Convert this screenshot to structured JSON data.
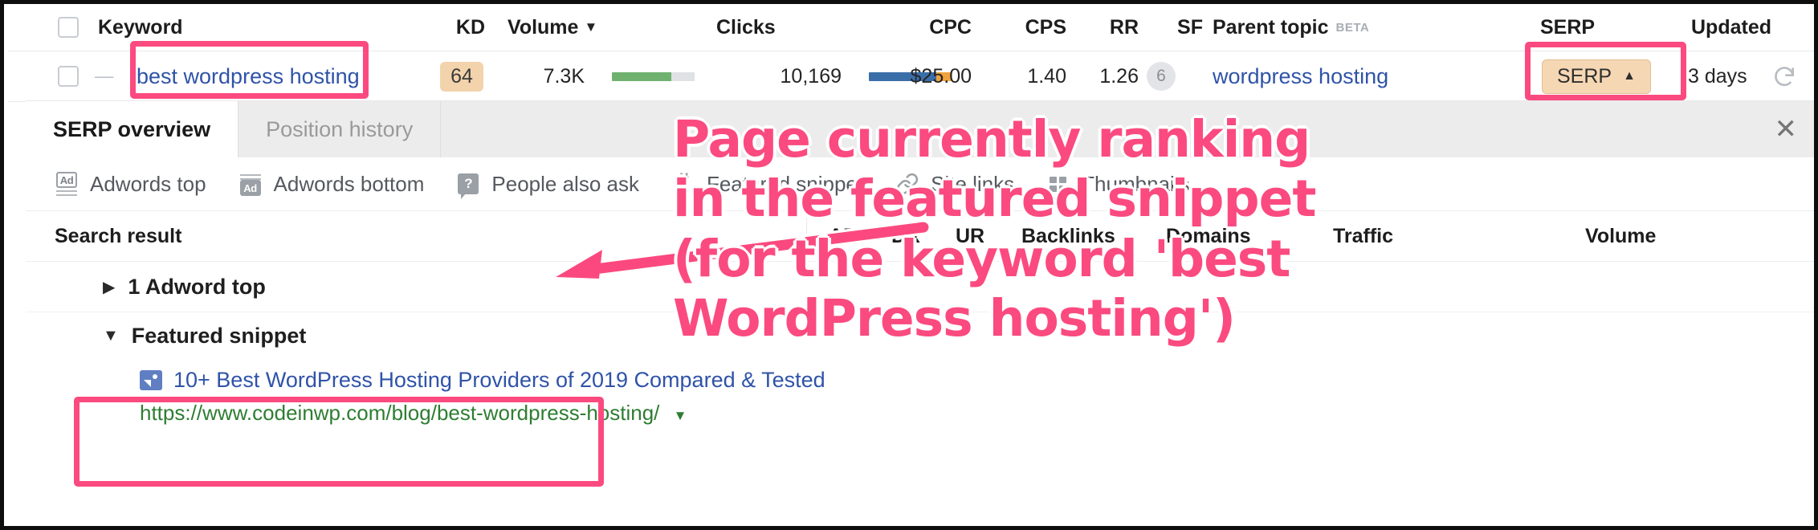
{
  "keyword_table": {
    "columns": [
      {
        "label": "Keyword"
      },
      {
        "label": "KD"
      },
      {
        "label": "Volume",
        "sorted": "desc"
      },
      {
        "label": "Clicks"
      },
      {
        "label": "CPC"
      },
      {
        "label": "CPS"
      },
      {
        "label": "RR"
      },
      {
        "label": "SF"
      },
      {
        "label": "Parent topic",
        "badge": "BETA"
      },
      {
        "label": "SERP"
      },
      {
        "label": "Updated"
      }
    ],
    "row": {
      "keyword": "best wordpress hosting",
      "kd": "64",
      "volume": "7.3K",
      "clicks": "10,169",
      "cpc": "$25.00",
      "cps": "1.40",
      "rr": "1.26",
      "sf": "6",
      "parent_topic": "wordpress hosting",
      "serp_button": "SERP",
      "updated": "3 days",
      "refresh_icon": "refresh-icon",
      "volume_bar": {
        "fill_pct": 72,
        "color": "#6fb26f"
      },
      "clicks_bar": {
        "fill_pct": 88,
        "color": "#3a6ea8",
        "accent_color": "#f0a23c"
      }
    }
  },
  "serp_panel": {
    "tabs": [
      {
        "label": "SERP overview",
        "active": true
      },
      {
        "label": "Position history",
        "active": false
      }
    ],
    "close_icon": "close-icon",
    "features": [
      {
        "label": "Adwords top",
        "icon": "adwords-top-icon"
      },
      {
        "label": "Adwords bottom",
        "icon": "adwords-bottom-icon"
      },
      {
        "label": "People also ask",
        "icon": "question-box-icon"
      },
      {
        "label": "Featured snippet",
        "icon": "quote-icon"
      },
      {
        "label": "Site links",
        "icon": "chain-link-icon"
      },
      {
        "label": "Thumbnails",
        "icon": "thumbnails-icon"
      }
    ],
    "result_columns": [
      {
        "label": "Search result"
      },
      {
        "label": "AR"
      },
      {
        "label": "DR"
      },
      {
        "label": "UR"
      },
      {
        "label": "Backlinks"
      },
      {
        "label": "Domains"
      },
      {
        "label": "Traffic"
      },
      {
        "label": "Volume"
      }
    ],
    "results": [
      {
        "type": "group",
        "expanded": false,
        "label": "1 Adword top"
      },
      {
        "type": "featured_snippet",
        "position": "1",
        "expanded": true,
        "label": "Featured snippet",
        "title": "10+ Best WordPress Hosting Providers of 2019 Compared & Tested",
        "url": "https://www.codeinwp.com/blog/best-wordpress-hosting/",
        "title_icon": "image-result-icon",
        "url_caret": "chevron-down-icon"
      }
    ]
  },
  "annotation": {
    "text": "Page currently ranking\nin the featured snippet\n(for the keyword 'best\nWordPress hosting')",
    "color": "#fb4a7f",
    "highlights": [
      {
        "name": "keyword-highlight"
      },
      {
        "name": "serp-button-highlight"
      },
      {
        "name": "featured-snippet-highlight"
      }
    ],
    "arrow": "annotation-arrow"
  }
}
